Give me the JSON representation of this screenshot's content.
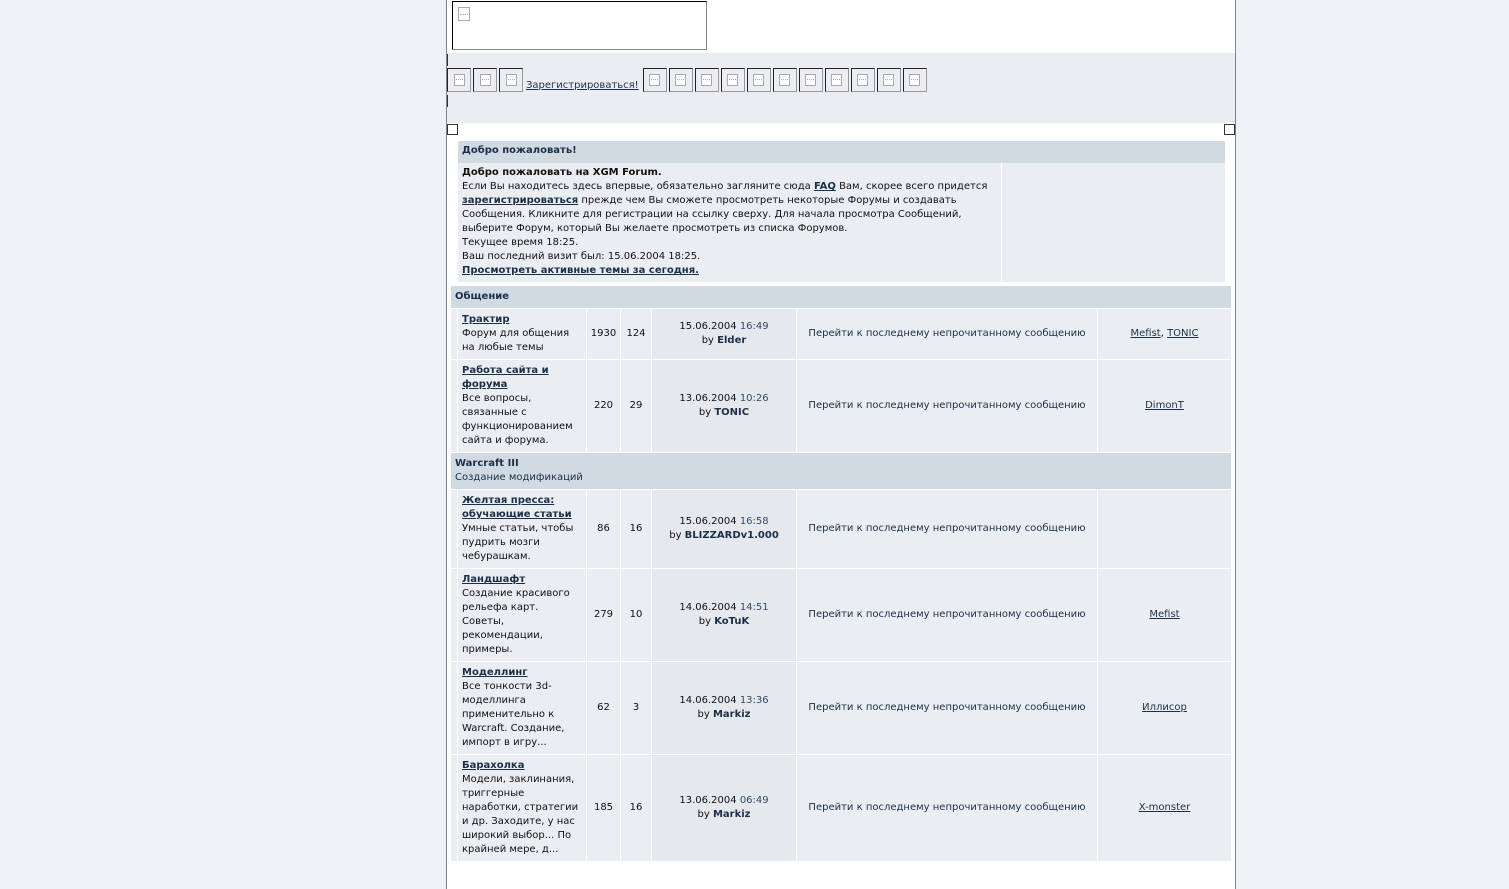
{
  "nav": {
    "register_label": "Зарегистрироваться!",
    "left_icons": [
      "broken-image",
      "broken-image",
      "broken-image"
    ],
    "right_icons": [
      "broken-image",
      "broken-image",
      "broken-image",
      "broken-image",
      "broken-image",
      "broken-image",
      "broken-image",
      "broken-image",
      "broken-image",
      "broken-image",
      "broken-image"
    ]
  },
  "welcome": {
    "header": "Добро пожаловать!",
    "title": "Добро пожаловать на XGM Forum.",
    "text1": "Если Вы находитесь здесь впервые, обязательно загляните сюда ",
    "faq_link": "FAQ",
    "text2": " Вам, скорее всего придется ",
    "register_link": "зарегистрироваться",
    "text3": " прежде чем Вы сможете просмотреть некоторые Форумы и создавать Сообщения. Кликните для регистрации на ссылку сверху. Для начала просмотра Сообщений, выберите Форум, который Вы желаете просмотреть из списка Форумов.",
    "current_time": "Текущее время 18:25.",
    "last_visit": "Ваш последний визит был: 15.06.2004 18:25.",
    "active_topics_link": "Просмотреть активные темы за сегодня."
  },
  "categories": [
    {
      "title": "Общение",
      "subtitle": "",
      "forums": [
        {
          "name": "Трактир",
          "desc": "Форум для общения на любые темы",
          "posts": "1930",
          "topics": "124",
          "date": "15.06.2004",
          "time": "16:49",
          "by": "by",
          "author": "Elder",
          "goto": "Перейти к последнему непрочитанному сообщению",
          "mods": [
            "Mefist",
            "TONIC"
          ]
        },
        {
          "name": "Работа сайта и форума",
          "desc": "Все вопросы, связанные с функционированием сайта и форума.",
          "posts": "220",
          "topics": "29",
          "date": "13.06.2004",
          "time": "10:26",
          "by": "by",
          "author": "TONIC",
          "goto": "Перейти к последнему непрочитанному сообщению",
          "mods": [
            "DimonT"
          ]
        }
      ]
    },
    {
      "title": "Warcraft III",
      "subtitle": "Создание модификаций",
      "forums": [
        {
          "name": "Желтая пресса: обучающие статьи",
          "desc": "Умные статьи, чтобы пудрить мозги чебурашкам.",
          "posts": "86",
          "topics": "16",
          "date": "15.06.2004",
          "time": "16:58",
          "by": "by",
          "author": "BLIZZARDv1.000",
          "goto": "Перейти к последнему непрочитанному сообщению",
          "mods": []
        },
        {
          "name": "Ландшафт",
          "desc": "Создание красивого рельефа карт. Советы, рекомендации, примеры.",
          "posts": "279",
          "topics": "10",
          "date": "14.06.2004",
          "time": "14:51",
          "by": "by",
          "author": "KoTuK",
          "goto": "Перейти к последнему непрочитанному сообщению",
          "mods": [
            "Mefist"
          ]
        },
        {
          "name": "Моделлинг",
          "desc": "Все тонкости 3d-моделлинга применительно к Warcraft. Создание, импорт в игру...",
          "posts": "62",
          "topics": "3",
          "date": "14.06.2004",
          "time": "13:36",
          "by": "by",
          "author": "Markiz",
          "goto": "Перейти к последнему непрочитанному сообщению",
          "mods": [
            "Иллисор"
          ]
        },
        {
          "name": "Барахолка",
          "desc": "Модели, заклинания, триггерные наработки, стратегии и др. Заходите, у нас широкий выбор... По крайней мере, д...",
          "posts": "185",
          "topics": "16",
          "date": "13.06.2004",
          "time": "06:49",
          "by": "by",
          "author": "Markiz",
          "goto": "Перейти к последнему непрочитанному сообщению",
          "mods": [
            "X-monster"
          ]
        }
      ]
    }
  ]
}
